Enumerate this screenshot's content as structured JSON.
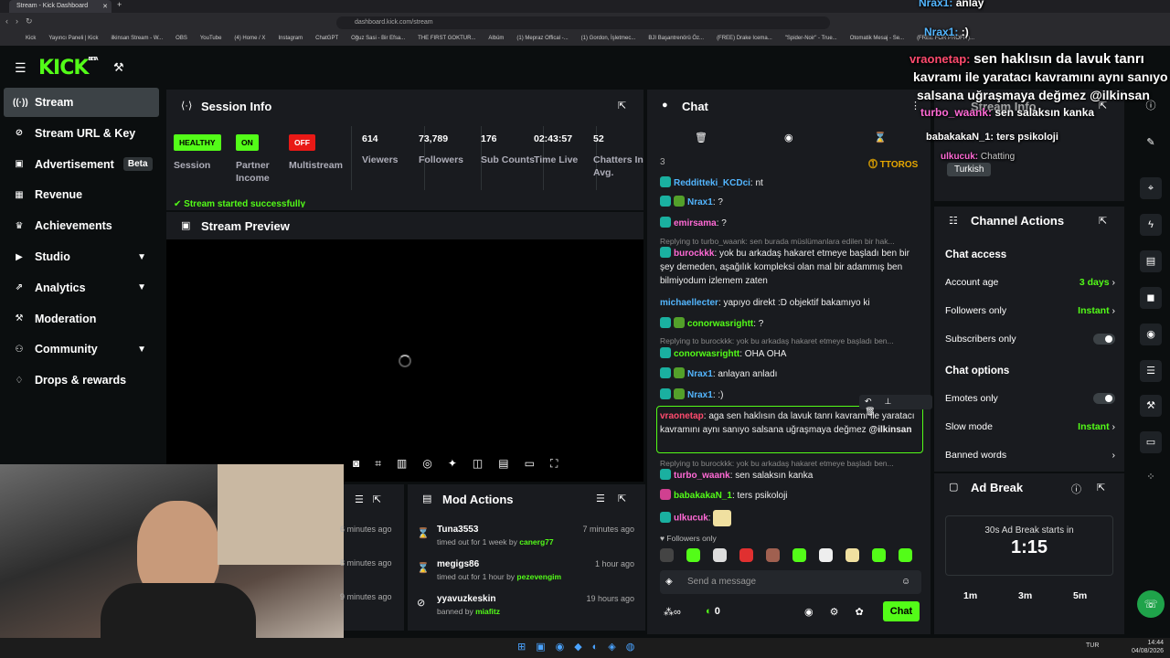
{
  "browser": {
    "tab_title": "Stream - Kick Dashboard",
    "url": "dashboard.kick.com/stream",
    "bookmarks": [
      "Kick",
      "Yayıncı Paneli | Kick",
      "ilkinsan Stream - W...",
      "OBS",
      "YouTube",
      "(4) Home / X",
      "Instagram",
      "ChatGPT",
      "Oğuz Sasi - Bir Efsa...",
      "THE FIRST GOKTUR...",
      "Albüm",
      "(1) Mepraz Offical -...",
      "(1) Gordon, İşletmec...",
      "BJI Başantrenörü Öz...",
      "(FREE) Drake Icema...",
      "\"Spider-Noir\" - True...",
      "Otomatik Mesaj - Se...",
      "(FREE FOR PROFIT)..."
    ]
  },
  "logo": {
    "text": "KICK",
    "beta": "BETA"
  },
  "sidebar": {
    "items": [
      {
        "label": "Stream",
        "icon": "broadcast-icon"
      },
      {
        "label": "Stream URL & Key",
        "icon": "link-icon"
      },
      {
        "label": "Advertisement",
        "icon": "ad-icon",
        "badge": "Beta"
      },
      {
        "label": "Revenue",
        "icon": "revenue-icon"
      },
      {
        "label": "Achievements",
        "icon": "trophy-icon"
      },
      {
        "label": "Studio",
        "icon": "studio-icon"
      },
      {
        "label": "Analytics",
        "icon": "analytics-icon"
      },
      {
        "label": "Moderation",
        "icon": "wrench-icon"
      },
      {
        "label": "Community",
        "icon": "community-icon"
      },
      {
        "label": "Drops & rewards",
        "icon": "gift-icon"
      }
    ]
  },
  "session": {
    "title": "Session Info",
    "stats": [
      {
        "badge": "HEALTHY",
        "label": "Session",
        "color": "#53fc18"
      },
      {
        "badge": "ON",
        "label": "Partner Income",
        "color": "#53fc18"
      },
      {
        "badge": "OFF",
        "label": "Multistream",
        "color": "#e91916"
      },
      {
        "value": "614",
        "label": "Viewers"
      },
      {
        "value": "73,789",
        "label": "Followers"
      },
      {
        "value": "176",
        "label": "Sub Counts"
      },
      {
        "value": "02:43:57",
        "label": "Time Live"
      },
      {
        "value": "52",
        "label": "Chatters In Avg."
      }
    ],
    "notice": "Stream started successfully"
  },
  "preview": {
    "title": "Stream Preview"
  },
  "mod_actions": {
    "title": "Mod Actions",
    "left_times": [
      "6 minutes ago",
      "8 minutes ago",
      "9 minutes ago"
    ],
    "items": [
      {
        "user": "Tuna3553",
        "detail": "timed out for 1 week by",
        "mod": "canerg77",
        "time": "7 minutes ago",
        "icon": "hourglass-icon"
      },
      {
        "user": "megigs86",
        "detail": "timed out for 1 hour by",
        "mod": "pezevengim",
        "time": "1 hour ago",
        "icon": "hourglass-icon"
      },
      {
        "user": "yyavuzkeskin",
        "detail": "banned by",
        "mod": "miafitz",
        "time": "19 hours ago",
        "icon": "ban-icon"
      }
    ]
  },
  "chat": {
    "title": "Chat",
    "pinned_count": "3",
    "pinned_user": "TTOROS",
    "reply1": "Replying to turbo_waank: sen burada müslümanlara edilen bir hak...",
    "reply2": "Replying to burockkk: yok bu arkadaş hakaret etmeye başladı ben...",
    "reply3": "Replying to burockkk: yok bu arkadaş hakaret etmeye başladı ben...",
    "messages": [
      {
        "user": "Redditteki_KCDci",
        "text": "nt",
        "color": "#53b6ff"
      },
      {
        "user": "Nrax1",
        "text": "?",
        "color": "#53b6ff"
      },
      {
        "user": "emirsama",
        "text": "?",
        "color": "#ff6ad5"
      },
      {
        "user": "burockkk",
        "text": "yok bu arkadaş hakaret etmeye başladı ben bir şey demeden, aşağılık kompleksi olan mal bir adammış ben bilmiyodum izlemem zaten",
        "color": "#ff6ad5"
      },
      {
        "user": "michaellecter",
        "text": "yapıyo direkt :D objektif bakamıyo ki",
        "color": "#53b6ff"
      },
      {
        "user": "conorwasrightt",
        "text": "?",
        "color": "#53fc18"
      },
      {
        "user": "conorwasrightt",
        "text": "OHA OHA",
        "color": "#53fc18"
      },
      {
        "user": "Nrax1",
        "text": "anlayan anladı",
        "color": "#53b6ff"
      },
      {
        "user": "Nrax1",
        "text": ":)",
        "color": "#53b6ff"
      },
      {
        "user": "vraonetap",
        "text": "aga sen haklısın da lavuk tanrı kavramı ile yaratacı kavramını aynı sanıyo salsana uğraşmaya değmez",
        "mention": "@ilkinsan",
        "color": "#ff4b6e"
      },
      {
        "user": "turbo_waank",
        "text": "sen salaksın kanka",
        "color": "#ff6ad5"
      },
      {
        "user": "babakakaN_1",
        "text": "ters psikoloji",
        "color": "#53fc18"
      },
      {
        "user": "ulkucuk",
        "text": "",
        "color": "#ff6ad5"
      }
    ],
    "followers_only": "Followers only",
    "input_placeholder": "Send a message",
    "points": "0",
    "send_label": "Chat"
  },
  "channel_actions": {
    "title": "Channel Actions",
    "chat_access": "Chat access",
    "account_age_label": "Account age",
    "account_age_value": "3 days",
    "followers_only_label": "Followers only",
    "followers_only_value": "Instant",
    "subscribers_only_label": "Subscribers only",
    "chat_options": "Chat options",
    "emotes_only_label": "Emotes only",
    "slow_mode_label": "Slow mode",
    "slow_mode_value": "Instant",
    "banned_words_label": "Banned words"
  },
  "ad_break": {
    "title": "Ad Break",
    "starts_in": "30s Ad Break starts in",
    "countdown": "1:15",
    "options": [
      "1m",
      "3m",
      "5m"
    ]
  },
  "overlay": {
    "line1_user": "Nrax1:",
    "line1_text": "anlay",
    "line2_user": "Nrax1:",
    "line2_text": ":)",
    "line3_user": "vraonetap:",
    "line3_text": "sen haklısın da lavuk tanrı",
    "line4": "kavramı ile yaratacı kavramını aynı sanıyo",
    "line5": "salsana uğraşmaya değmez @ilkinsan",
    "line6_user": "turbo_waank:",
    "line6_text": "sen salaksın kanka",
    "line7_user": "babakakaN_1:",
    "line7_text": "ters psikoloji",
    "line8_user": "ulkucuk:",
    "chatting": "Chatting",
    "turkish": "Turkish",
    "stream_info": "Stream Info"
  },
  "taskbar": {
    "lang": "TUR",
    "time": "14:44",
    "date": "04/08/2026"
  }
}
